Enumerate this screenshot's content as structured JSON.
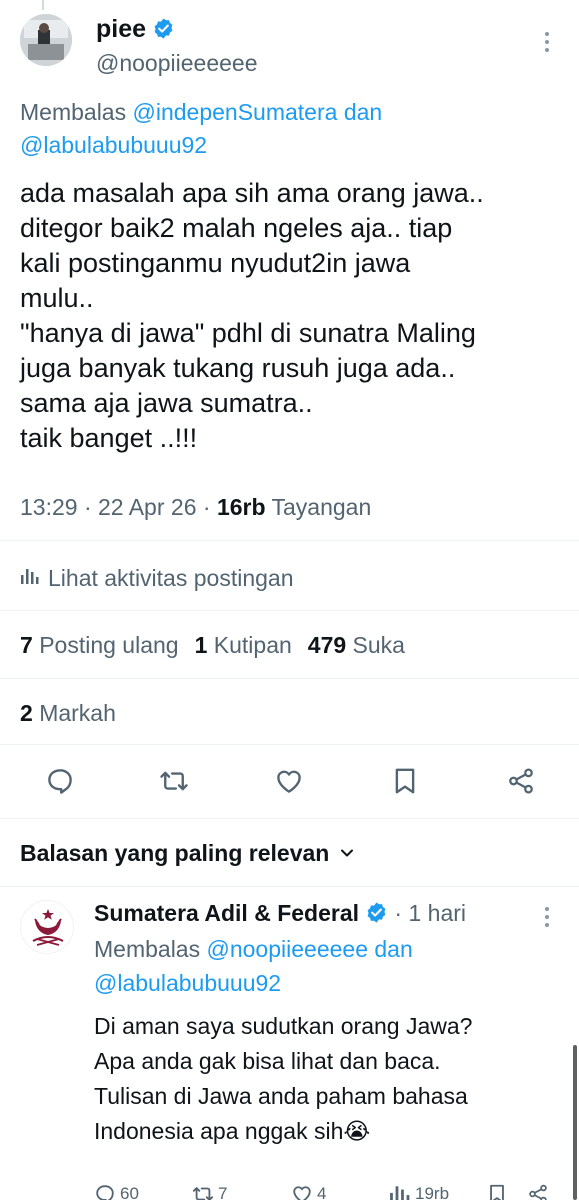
{
  "tweet": {
    "author_name": "piee",
    "author_handle": "@noopiieeeeee",
    "reply_prefix": "Membalas",
    "reply_user1": "@indepenSumatera",
    "reply_and": "dan",
    "reply_user2": "@labulabubuuu92",
    "text": "ada masalah apa sih ama orang jawa..\nditegor baik2 malah ngeles aja.. tiap\nkali postinganmu nyudut2in jawa\nmulu..\n\"hanya di jawa\" pdhl di sunatra Maling\njuga banyak tukang rusuh juga ada..\nsama aja jawa sumatra..\ntaik banget ..!!!",
    "time": "13:29",
    "date": "22 Apr 26",
    "views_count": "16rb",
    "views_label": "Tayangan",
    "activity_label": "Lihat aktivitas postingan",
    "reposts_count": "7",
    "reposts_label": "Posting ulang",
    "quotes_count": "1",
    "quotes_label": "Kutipan",
    "likes_count": "479",
    "likes_label": "Suka",
    "bookmarks_count": "2",
    "bookmarks_label": "Markah"
  },
  "replies_sort_label": "Balasan yang paling relevan",
  "reply": {
    "author_name": "Sumatera Adil & Federal",
    "time_ago": "1 hari",
    "reply_prefix": "Membalas",
    "reply_user1": "@noopiieeeeee",
    "reply_and": "dan",
    "reply_user2": "@labulabubuuu92",
    "text": "Di aman saya sudutkan orang Jawa?\nApa anda gak bisa lihat dan baca.\nTulisan di Jawa anda paham bahasa\nIndonesia apa nggak sih😭",
    "replies": "60",
    "reposts": "7",
    "likes": "4",
    "views": "19rb"
  },
  "colors": {
    "accent": "#1d9bf0",
    "muted": "#536471",
    "text": "#0f1419",
    "divider": "#eff3f4"
  },
  "icons": [
    "verified-badge-icon",
    "more-icon",
    "chart-icon",
    "reply-icon",
    "repost-icon",
    "like-icon",
    "bookmark-icon",
    "share-icon",
    "chevron-down-icon",
    "emblem-icon"
  ]
}
